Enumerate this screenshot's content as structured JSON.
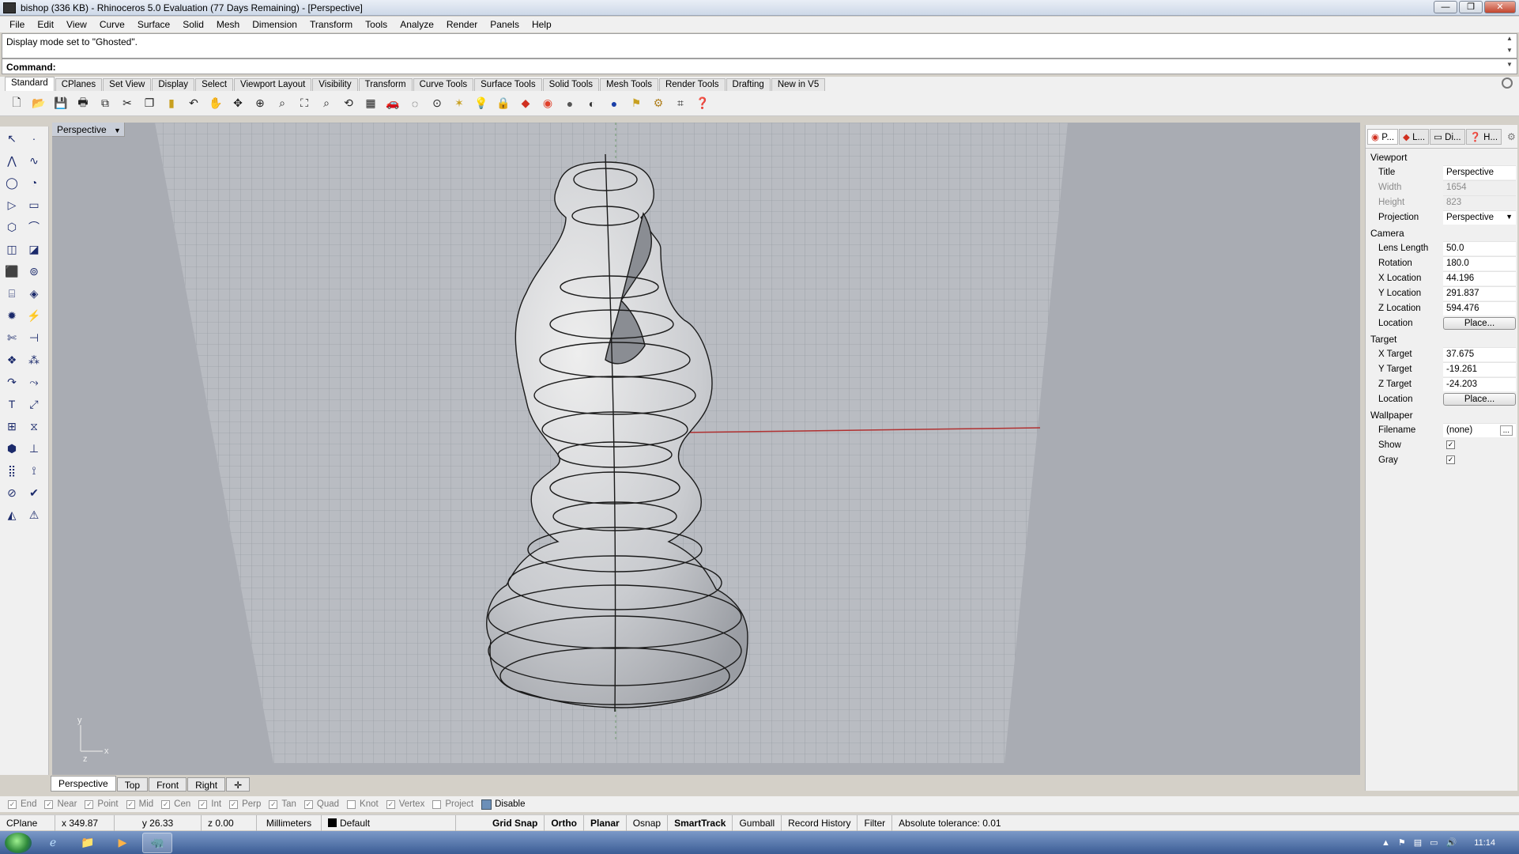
{
  "title_bar": {
    "text": "bishop (336 KB) - Rhinoceros 5.0 Evaluation (77 Days Remaining) - [Perspective]",
    "minimize": "—",
    "restore": "❐",
    "close": "✕"
  },
  "menu": [
    "File",
    "Edit",
    "View",
    "Curve",
    "Surface",
    "Solid",
    "Mesh",
    "Dimension",
    "Transform",
    "Tools",
    "Analyze",
    "Render",
    "Panels",
    "Help"
  ],
  "command_history": "Display mode set to \"Ghosted\".",
  "command_prompt": "Command:",
  "toolbar_tabs": [
    "Standard",
    "CPlanes",
    "Set View",
    "Display",
    "Select",
    "Viewport Layout",
    "Visibility",
    "Transform",
    "Curve Tools",
    "Surface Tools",
    "Solid Tools",
    "Mesh Tools",
    "Render Tools",
    "Drafting",
    "New in V5"
  ],
  "toolbar_icons": [
    "new-icon",
    "open-icon",
    "save-icon",
    "print-icon",
    "import-icon",
    "cut-icon",
    "copy-icon",
    "paste-icon",
    "undo-icon",
    "pan-icon",
    "rotate-view-icon",
    "zoom-in-icon",
    "zoom-window-icon",
    "zoom-extents-icon",
    "zoom-selected-icon",
    "rotate-icon",
    "grid-icon",
    "car-icon",
    "hide-icon",
    "cplane-icon",
    "snap-icon",
    "light-icon",
    "lock-icon",
    "layer-icon",
    "color-icon",
    "shade-icon",
    "render-icon",
    "material-icon",
    "select-icon",
    "settings-icon",
    "tools-icon",
    "help-icon"
  ],
  "viewport": {
    "label": "Perspective",
    "axis_x": "x",
    "axis_y": "y",
    "axis_z": "z"
  },
  "viewport_tabs": [
    "Perspective",
    "Top",
    "Front",
    "Right"
  ],
  "right_panel": {
    "tabs": [
      "P...",
      "L...",
      "Di...",
      "H..."
    ],
    "sections": {
      "viewport": "Viewport",
      "camera": "Camera",
      "target": "Target",
      "wallpaper": "Wallpaper"
    },
    "viewport_props": [
      {
        "k": "Title",
        "v": "Perspective"
      },
      {
        "k": "Width",
        "v": "1654"
      },
      {
        "k": "Height",
        "v": "823"
      },
      {
        "k": "Projection",
        "v": "Perspective"
      }
    ],
    "camera_props": [
      {
        "k": "Lens Length",
        "v": "50.0"
      },
      {
        "k": "Rotation",
        "v": "180.0"
      },
      {
        "k": "X Location",
        "v": "44.196"
      },
      {
        "k": "Y Location",
        "v": "291.837"
      },
      {
        "k": "Z Location",
        "v": "594.476"
      },
      {
        "k": "Location",
        "v": "Place..."
      }
    ],
    "target_props": [
      {
        "k": "X Target",
        "v": "37.675"
      },
      {
        "k": "Y Target",
        "v": "-19.261"
      },
      {
        "k": "Z Target",
        "v": "-24.203"
      },
      {
        "k": "Location",
        "v": "Place..."
      }
    ],
    "wallpaper_props": [
      {
        "k": "Filename",
        "v": "(none)"
      },
      {
        "k": "Show",
        "v": ""
      },
      {
        "k": "Gray",
        "v": ""
      }
    ]
  },
  "osnaps": [
    "End",
    "Near",
    "Point",
    "Mid",
    "Cen",
    "Int",
    "Perp",
    "Tan",
    "Quad",
    "Knot",
    "Vertex",
    "Project"
  ],
  "osnap_disable": "Disable",
  "status": {
    "cplane": "CPlane",
    "x": "x 349.87",
    "y": "y 26.33",
    "z": "z 0.00",
    "units": "Millimeters",
    "layer": "Default",
    "grid_snap": "Grid Snap",
    "ortho": "Ortho",
    "planar": "Planar",
    "osnap": "Osnap",
    "smarttrack": "SmartTrack",
    "gumball": "Gumball",
    "record_history": "Record History",
    "filter": "Filter",
    "tolerance": "Absolute tolerance: 0.01"
  },
  "taskbar": {
    "clock": "11:14"
  }
}
